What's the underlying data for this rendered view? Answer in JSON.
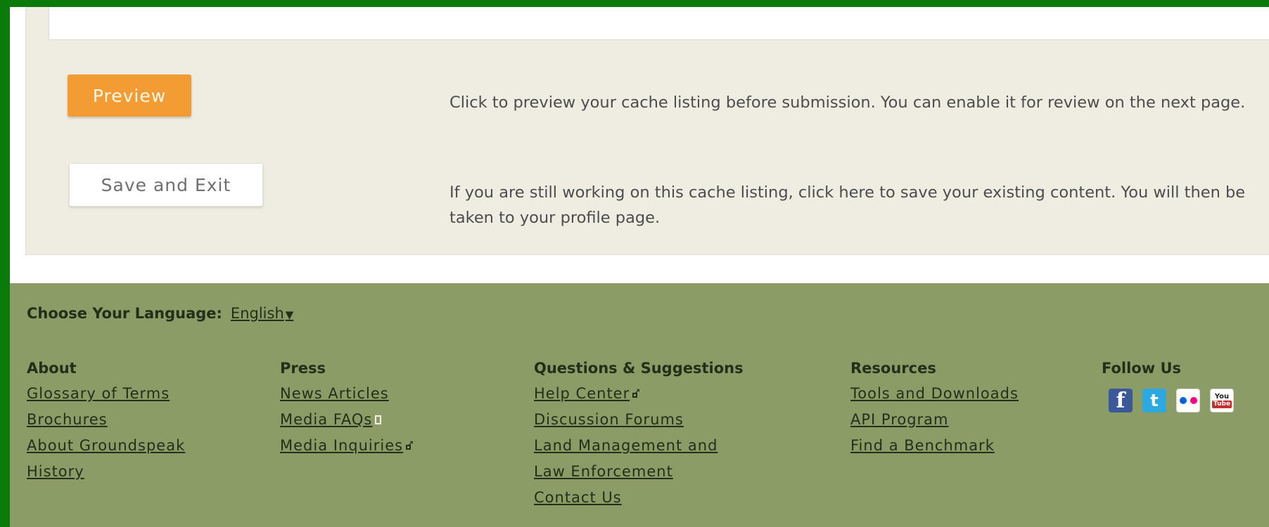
{
  "actions": {
    "preview_label": "Preview",
    "preview_description": "Click to preview your cache listing before submission. You can enable it for review on the next page.",
    "save_label": "Save and Exit",
    "save_description": "If you are still working on this cache listing, click here to save your existing content. You will then be taken to your profile page."
  },
  "footer": {
    "language_label": "Choose Your Language:",
    "language_value": "English",
    "columns": [
      {
        "heading": "About",
        "links": [
          "Glossary of Terms",
          "Brochures",
          "About Groundspeak",
          "History"
        ]
      },
      {
        "heading": "Press",
        "links": [
          "News Articles",
          "Media FAQs",
          "Media Inquiries"
        ]
      },
      {
        "heading": "Questions & Suggestions",
        "links": [
          "Help Center",
          "Discussion Forums",
          "Land Management and",
          "Law Enforcement",
          "Contact Us"
        ]
      },
      {
        "heading": "Resources",
        "links": [
          "Tools and Downloads",
          "API Program",
          "Find a Benchmark"
        ]
      },
      {
        "heading": "Follow Us"
      }
    ],
    "social": {
      "icons": [
        "facebook-icon",
        "twitter-icon",
        "flickr-icon",
        "youtube-icon"
      ],
      "youtube_you": "You",
      "youtube_tube": "Tube"
    }
  },
  "colors": {
    "frame_border": "#0a7a0a",
    "preview_button": "#f39c33",
    "footer_bg": "#8b9c66",
    "panel_bg": "#efece2"
  }
}
